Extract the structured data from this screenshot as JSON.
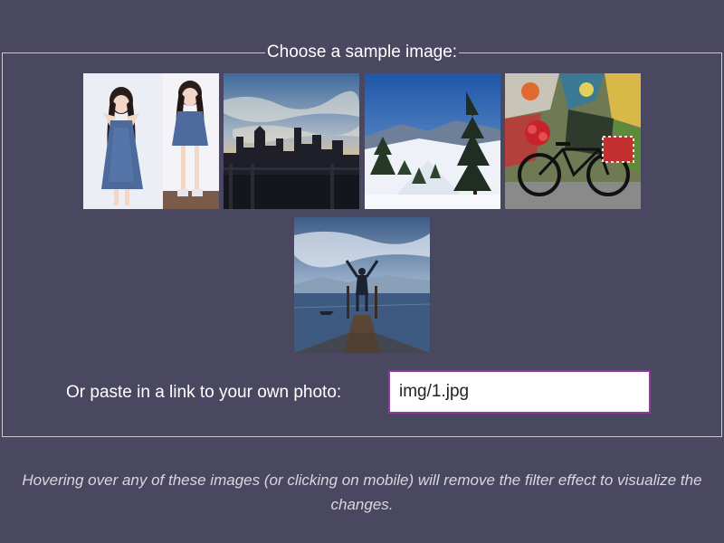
{
  "gallery": {
    "legend": "Choose a sample image:",
    "images": [
      {
        "icon": "portrait-image",
        "subject": "girls-in-denim-dress"
      },
      {
        "icon": "city-skyline-image",
        "subject": "city-sunset"
      },
      {
        "icon": "mountain-trees-image",
        "subject": "snowy-mountain-pines"
      },
      {
        "icon": "bicycle-graffiti-image",
        "subject": "bike-against-graffiti-wall"
      },
      {
        "icon": "pier-lake-image",
        "subject": "person-on-pier"
      }
    ]
  },
  "url_form": {
    "label": "Or paste in a link to your own photo:",
    "value": "img/1.jpg"
  },
  "note": "Hovering over any of these images (or clicking on mobile) will remove the filter effect to visualize the changes.",
  "colors": {
    "background": "#4a4860",
    "input_border": "#8e3b9a",
    "border": "#c9c8d2"
  }
}
